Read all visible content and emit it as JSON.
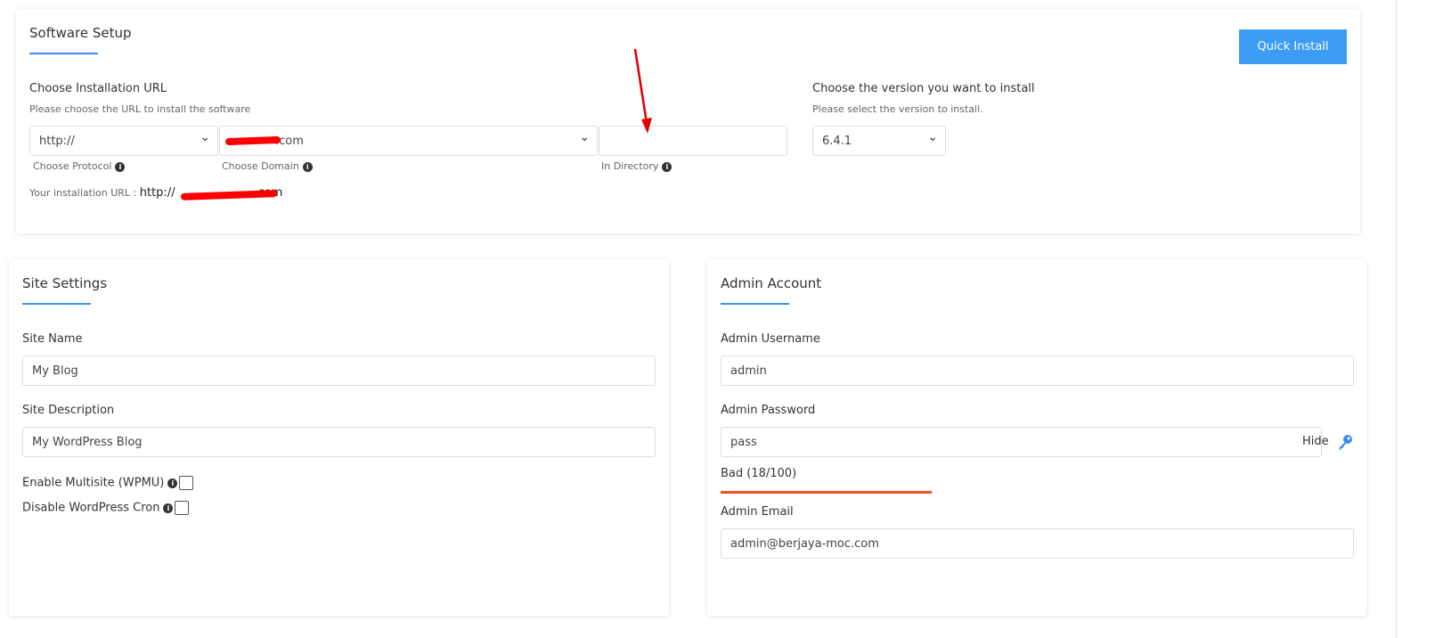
{
  "software_setup": {
    "title": "Software Setup",
    "quick_install": "Quick Install",
    "install_url_label": "Choose Installation URL",
    "install_url_help": "Please choose the URL to install the software",
    "protocol_value": "http://",
    "protocol_label": "Choose Protocol",
    "domain_value": ".com",
    "domain_label": "Choose Domain",
    "directory_value": "",
    "directory_label": "In Directory",
    "your_url_label": "Your installation URL :",
    "your_url_prefix": "http://",
    "your_url_suffix": "com",
    "version_label": "Choose the version you want to install",
    "version_help": "Please select the version to install.",
    "version_value": "6.4.1"
  },
  "site_settings": {
    "title": "Site Settings",
    "site_name_label": "Site Name",
    "site_name_value": "My Blog",
    "site_desc_label": "Site Description",
    "site_desc_value": "My WordPress Blog",
    "multisite_label": "Enable Multisite (WPMU)",
    "cron_label": "Disable WordPress Cron"
  },
  "admin_account": {
    "title": "Admin Account",
    "username_label": "Admin Username",
    "username_value": "admin",
    "password_label": "Admin Password",
    "password_value": "pass",
    "hide_label": "Hide",
    "strength_label": "Bad (18/100)",
    "strength_score": 18,
    "strength_color": "#f4511e",
    "email_label": "Admin Email",
    "email_value": "admin@berjaya-moc.com"
  },
  "colors": {
    "accent": "#3d8ef0",
    "annotation_arrow": "#e00000"
  }
}
